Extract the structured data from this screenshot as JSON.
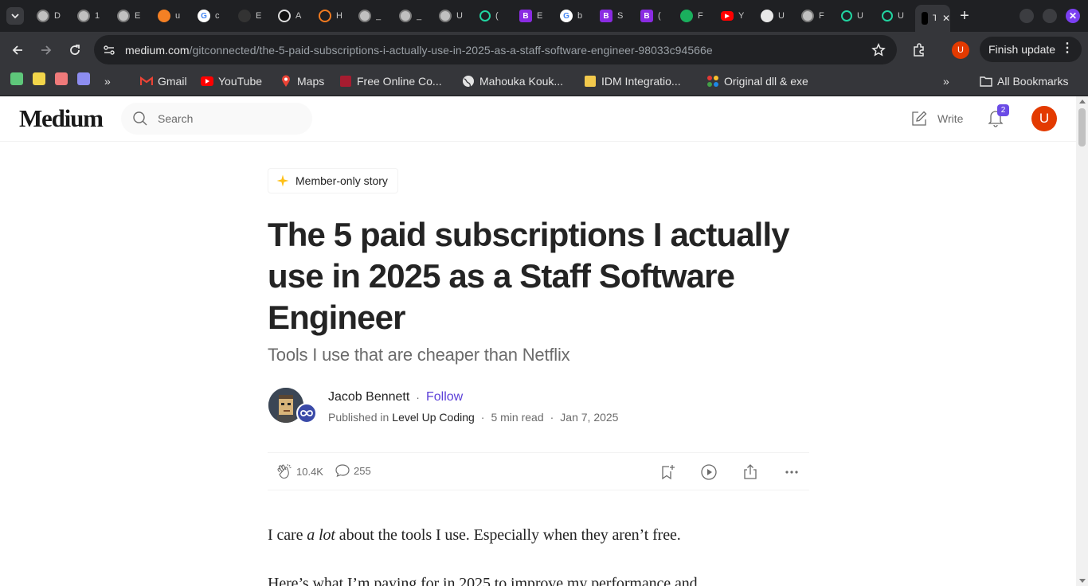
{
  "browser": {
    "tabs": [
      {
        "title": "D",
        "icon": "globe-icon",
        "color": "#5f6368"
      },
      {
        "title": "1",
        "icon": "globe-icon",
        "color": "#5f6368"
      },
      {
        "title": "E",
        "icon": "globe-icon",
        "color": "#5f6368"
      },
      {
        "title": "u",
        "icon": "stack-icon",
        "color": "#f48024"
      },
      {
        "title": "c",
        "icon": "google-icon",
        "color": "#ffffff"
      },
      {
        "title": "E",
        "icon": "dots-icon",
        "color": "#333333"
      },
      {
        "title": "A",
        "icon": "openai-icon",
        "color": "#ffffff"
      },
      {
        "title": "H",
        "icon": "ring-icon",
        "color": "#f47b20"
      },
      {
        "title": "_",
        "icon": "globe-icon",
        "color": "#5f6368"
      },
      {
        "title": "_",
        "icon": "globe-icon",
        "color": "#5f6368"
      },
      {
        "title": "U",
        "icon": "globe-icon",
        "color": "#5f6368"
      },
      {
        "title": "(",
        "icon": "react-icon",
        "color": "#21d4a0"
      },
      {
        "title": "E",
        "icon": "bootstrap-icon",
        "color": "#7952b3"
      },
      {
        "title": "b",
        "icon": "google-icon",
        "color": "#ffffff"
      },
      {
        "title": "S",
        "icon": "bootstrap-icon",
        "color": "#7952b3"
      },
      {
        "title": "(",
        "icon": "bootstrap-icon",
        "color": "#7952b3"
      },
      {
        "title": "F",
        "icon": "app-icon",
        "color": "#1aaf5d"
      },
      {
        "title": "Y",
        "icon": "youtube-icon",
        "color": "#ff0000"
      },
      {
        "title": "U",
        "icon": "github-icon",
        "color": "#ffffff"
      },
      {
        "title": "F",
        "icon": "globe-icon",
        "color": "#5f6368"
      },
      {
        "title": "U",
        "icon": "react-icon",
        "color": "#21d4a0"
      },
      {
        "title": "U",
        "icon": "react-icon",
        "color": "#21d4a0"
      },
      {
        "title": "T",
        "icon": "medium-icon",
        "color": "#000000",
        "active": true
      }
    ],
    "url_domain": "medium.com",
    "url_path": "/gitconnected/the-5-paid-subscriptions-i-actually-use-in-2025-as-a-staff-software-engineer-98033c94566e",
    "profile_initial": "U",
    "finish_update": "Finish update",
    "bookmarks": [
      {
        "label": "Gmail",
        "icon": "gmail-icon"
      },
      {
        "label": "YouTube",
        "icon": "youtube-icon"
      },
      {
        "label": "Maps",
        "icon": "maps-icon"
      },
      {
        "label": "Free Online Co...",
        "icon": "harvard-icon"
      },
      {
        "label": "Mahouka Kouk...",
        "icon": "globe-icon"
      },
      {
        "label": "IDM Integratio...",
        "icon": "idm-icon"
      },
      {
        "label": "Original dll & exe",
        "icon": "dll-icon"
      }
    ],
    "all_bookmarks": "All Bookmarks",
    "more_glyph": "»"
  },
  "medium": {
    "logo": "Medium",
    "search_placeholder": "Search",
    "write": "Write",
    "notifications_count": "2",
    "avatar_initial": "U",
    "member_label": "Member-only story",
    "title": "The 5 paid subscriptions I actually use in 2025 as a Staff Software Engineer",
    "subtitle": "Tools I use that are cheaper than Netflix",
    "author": "Jacob Bennett",
    "follow": "Follow",
    "published_in": "Published in",
    "publication": "Level Up Coding",
    "read_time": "5 min read",
    "date": "Jan 7, 2025",
    "claps": "10.4K",
    "responses": "255",
    "paragraph1_before": "I care ",
    "paragraph1_em": "a lot",
    "paragraph1_after": " about the tools I use. Especially when they aren’t free.",
    "paragraph2": "Here’s what I’m paying for in 2025 to improve my performance and",
    "colors": {
      "text": "#242424",
      "muted": "#6b6b6b",
      "follow": "#5b3fd8",
      "avatar": "#e33a00",
      "badge": "#6b4ce6",
      "star": "#ffc017"
    }
  }
}
